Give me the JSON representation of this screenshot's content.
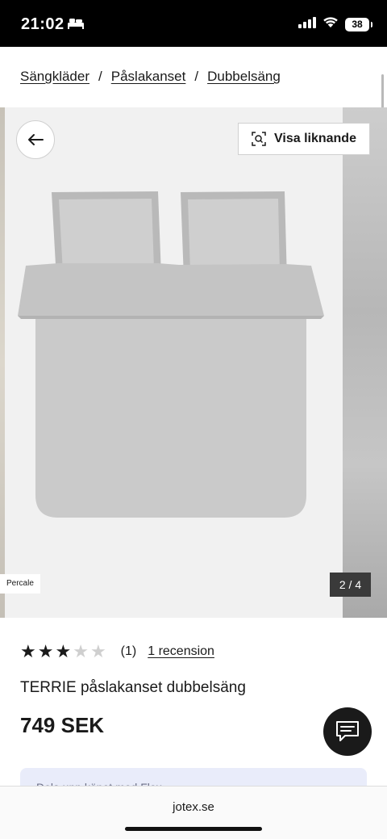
{
  "status_bar": {
    "time": "21:02",
    "battery": "38"
  },
  "breadcrumb": {
    "items": [
      "Sängkläder",
      "Påslakanset",
      "Dubbelsäng"
    ],
    "separator": "/"
  },
  "gallery": {
    "similar_label": "Visa liknande",
    "badge": "Percale",
    "counter": "2 / 4"
  },
  "product": {
    "rating": 3,
    "rating_max": 5,
    "rating_count": "(1)",
    "review_link": "1 recension",
    "title": "TERRIE påslakanset dubbelsäng",
    "price": "749 SEK"
  },
  "promo": {
    "text": "Dela upp köpet med Flex"
  },
  "browser": {
    "domain": "jotex.se"
  },
  "colors": {
    "accent": "#1a1a1a",
    "promo_bg": "#e9ecfa",
    "slide_counter_bg": "#3a3a3a"
  },
  "icons": [
    "bed-icon",
    "signal-icon",
    "wifi-icon",
    "battery-icon",
    "arrow-left-icon",
    "visual-search-icon",
    "star-icon",
    "chat-icon"
  ]
}
